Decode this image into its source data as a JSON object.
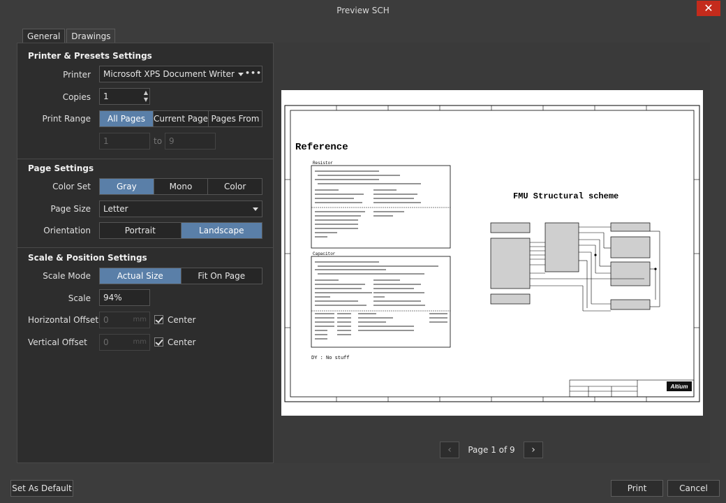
{
  "window": {
    "title": "Preview SCH",
    "close_glyph": "✕"
  },
  "tabs": [
    {
      "label": "General"
    },
    {
      "label": "Drawings"
    }
  ],
  "printer_section": {
    "title": "Printer & Presets Settings",
    "printer_label": "Printer",
    "printer_value": "Microsoft XPS Document Writer",
    "copies_label": "Copies",
    "copies_value": "1",
    "print_range_label": "Print Range",
    "print_range_options": [
      "All Pages",
      "Current Page",
      "Pages From"
    ],
    "print_range_selected": "All Pages",
    "range_from": "1",
    "range_to_label": "to",
    "range_to": "9"
  },
  "page_section": {
    "title": "Page Settings",
    "color_set_label": "Color Set",
    "color_set_options": [
      "Gray",
      "Mono",
      "Color"
    ],
    "color_set_selected": "Gray",
    "page_size_label": "Page Size",
    "page_size_value": "Letter",
    "orientation_label": "Orientation",
    "orientation_options": [
      "Portrait",
      "Landscape"
    ],
    "orientation_selected": "Landscape"
  },
  "scale_section": {
    "title": "Scale & Position Settings",
    "scale_mode_label": "Scale Mode",
    "scale_mode_options": [
      "Actual Size",
      "Fit On Page"
    ],
    "scale_mode_selected": "Actual Size",
    "scale_label": "Scale",
    "scale_value": "94%",
    "h_offset_label": "Horizontal Offset",
    "h_offset_value": "0",
    "v_offset_label": "Vertical Offset",
    "v_offset_value": "0",
    "offset_unit": "mm",
    "center_label": "Center"
  },
  "preview": {
    "sheet_heading": "Reference",
    "diagram_heading": "FMU Structural scheme",
    "box_resistor": "Resistor",
    "box_capacitor": "Capacitor",
    "dy_note": "DY : No stuff",
    "logo_text": "Altium",
    "page_label": "Page 1 of 9"
  },
  "footer": {
    "set_default_label": "Set As Default",
    "print_label": "Print",
    "cancel_label": "Cancel"
  },
  "colors": {
    "accent_selected": "#5a7fa8",
    "close_red": "#c42b1c"
  }
}
